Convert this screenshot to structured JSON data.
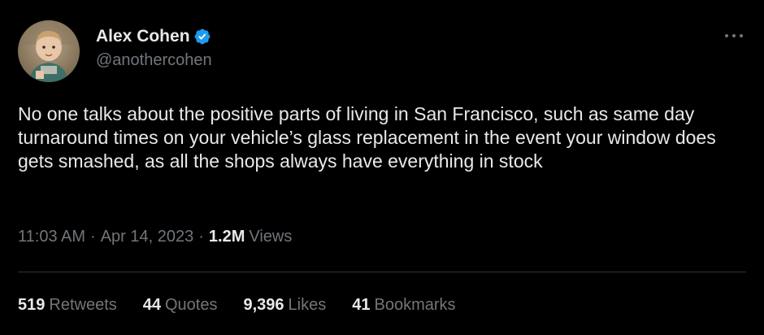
{
  "author": {
    "display_name": "Alex Cohen",
    "handle": "@anothercohen",
    "verified": true,
    "avatar_icon": "profile-photo-child-icon"
  },
  "tweet": {
    "text": "No one talks about the positive parts of living in San Francisco, such as same day turnaround times on your vehicle’s glass replacement in the event your window does gets smashed, as all the shops always have everything in stock"
  },
  "meta": {
    "time": "11:03 AM",
    "separator": "·",
    "date": "Apr 14, 2023",
    "views_count": "1.2M",
    "views_label": "Views"
  },
  "stats": {
    "retweets_count": "519",
    "retweets_label": "Retweets",
    "quotes_count": "44",
    "quotes_label": "Quotes",
    "likes_count": "9,396",
    "likes_label": "Likes",
    "bookmarks_count": "41",
    "bookmarks_label": "Bookmarks"
  },
  "colors": {
    "background": "#000000",
    "primary_text": "#e7e9ea",
    "secondary_text": "#71767b",
    "verified_blue": "#1d9bf0",
    "divider": "#2f3336"
  }
}
